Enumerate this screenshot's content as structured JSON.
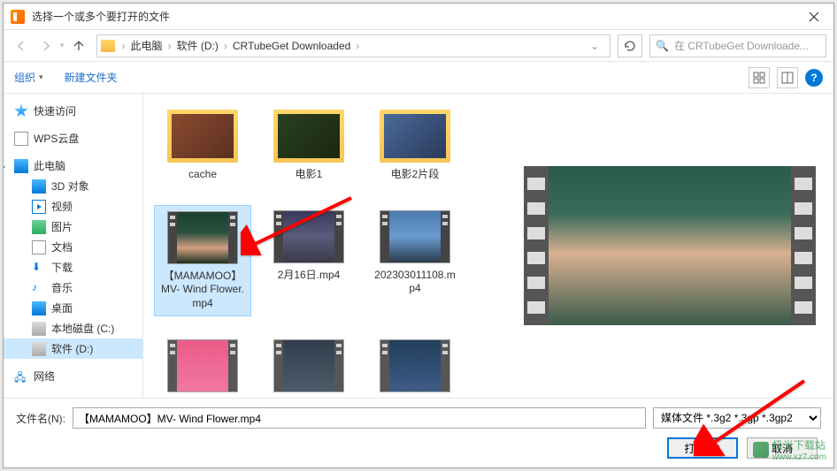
{
  "title": "选择一个或多个要打开的文件",
  "path": {
    "items": [
      "此电脑",
      "软件 (D:)",
      "CRTubeGet Downloaded"
    ]
  },
  "search": {
    "placeholder": "在 CRTubeGet Downloade..."
  },
  "toolbar": {
    "organize": "组织",
    "newfolder": "新建文件夹"
  },
  "sidebar": {
    "quickaccess": "快速访问",
    "wps": "WPS云盘",
    "thispc": "此电脑",
    "obj3d": "3D 对象",
    "video": "视频",
    "images": "图片",
    "docs": "文档",
    "downloads": "下载",
    "music": "音乐",
    "desktop": "桌面",
    "diskC": "本地磁盘 (C:)",
    "diskD": "软件 (D:)",
    "network": "网络"
  },
  "files": {
    "cache": "cache",
    "movie1": "电影1",
    "movie2seg": "电影2片段",
    "mamamoo": "【MAMAMOO】MV- Wind Flower.mp4",
    "feb16": "2月16日.mp4",
    "mar03": "202303011108.mp4"
  },
  "bottom": {
    "filename_label": "文件名(N):",
    "filename_value": "【MAMAMOO】MV- Wind Flower.mp4",
    "filetype": "媒体文件  *.3g2 *.3gp *.3gp2",
    "open": "打开(O)",
    "cancel": "取消"
  },
  "watermark": {
    "text": "极光下载站",
    "url": "www.xz7.com"
  }
}
